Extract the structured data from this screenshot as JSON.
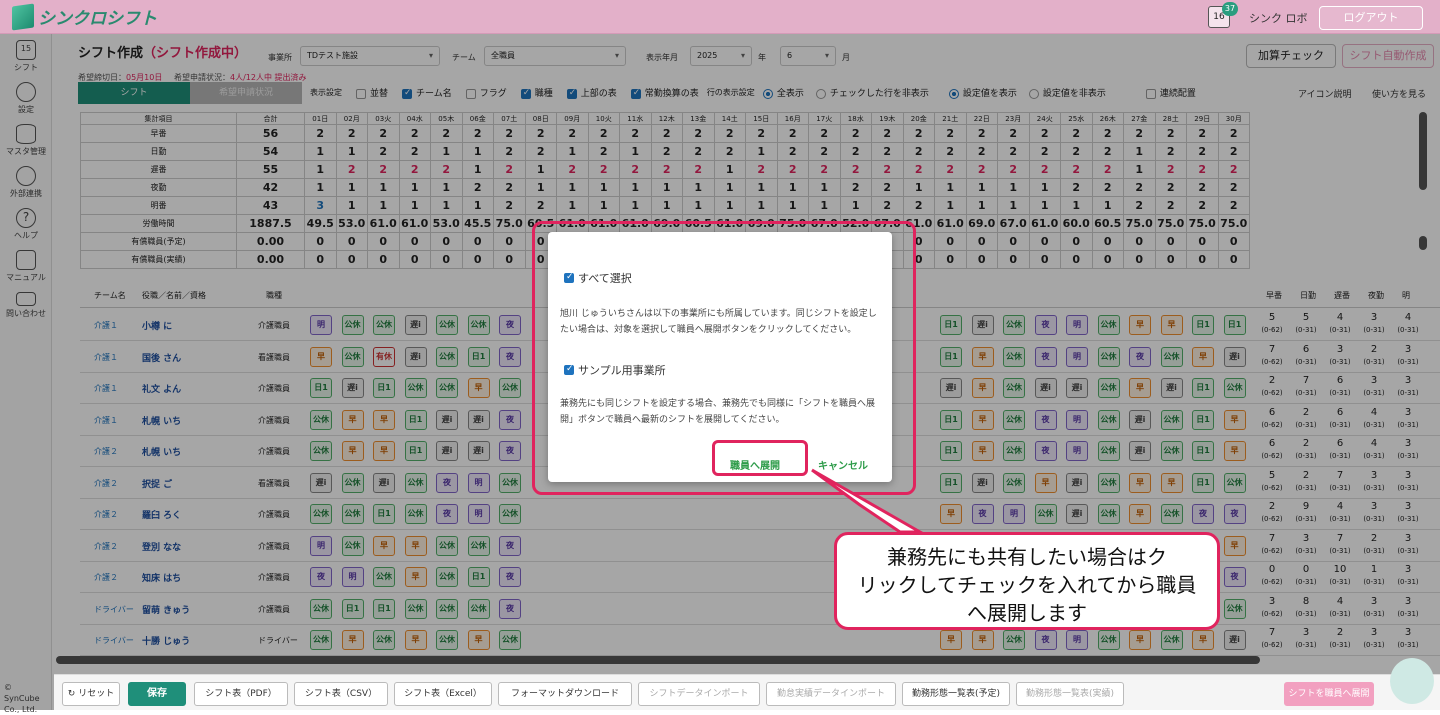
{
  "app": {
    "logo_text": "シンクロシフト",
    "cal_day": "16",
    "badge_count": "37",
    "user": "シンク ロボ",
    "logout": "ログアウト"
  },
  "sidebar": {
    "items": [
      {
        "label": "シフト",
        "icon": "calendar-icon"
      },
      {
        "label": "設定",
        "icon": "gear-icon"
      },
      {
        "label": "マスタ管理",
        "icon": "database-icon"
      },
      {
        "label": "外部連携",
        "icon": "cloud-sync-icon"
      },
      {
        "label": "ヘルプ",
        "icon": "help-icon"
      },
      {
        "label": "マニュアル",
        "icon": "edit-icon"
      },
      {
        "label": "問い合わせ",
        "icon": "mail-icon"
      }
    ],
    "cal_day": "15",
    "copyright": "© SynCube Co., Ltd."
  },
  "header": {
    "title": "シフト作成",
    "status": "（シフト作成中）",
    "office_label": "事業所",
    "office_value": "TDテスト施設",
    "team_label": "チーム",
    "team_value": "全職員",
    "ym_label": "表示年月",
    "year_value": "2025",
    "year_unit": "年",
    "month_value": "6",
    "month_unit": "月",
    "deadline_label": "希望締切日：",
    "deadline_value": "05月10日",
    "request_label": "希望申請状況：",
    "request_value": "4人/12人中 提出済み",
    "btn_check": "加算チェック",
    "btn_auto": "シフト自動作成"
  },
  "tabs": [
    {
      "label": "シフト",
      "active": true
    },
    {
      "label": "希望申請状況",
      "active": false
    }
  ],
  "options": {
    "display_label": "表示設定",
    "items": [
      {
        "label": "並替",
        "checked": false
      },
      {
        "label": "チーム名",
        "checked": true
      },
      {
        "label": "フラグ",
        "checked": false
      },
      {
        "label": "職種",
        "checked": true
      },
      {
        "label": "上部の表",
        "checked": true
      },
      {
        "label": "常勤換算の表",
        "checked": true
      }
    ],
    "row_label": "行の表示設定",
    "radios1": [
      {
        "label": "全表示",
        "on": true
      },
      {
        "label": "チェックした行を非表示",
        "on": false
      }
    ],
    "radios2": [
      {
        "label": "設定値を表示",
        "on": true
      },
      {
        "label": "設定値を非表示",
        "on": false
      }
    ],
    "renzoku": "連続配置",
    "icon_desc": "アイコン説明",
    "howto": "使い方を見る"
  },
  "summary": {
    "header": "集計項目",
    "total_label": "合計",
    "days": [
      "01日",
      "02月",
      "03火",
      "04水",
      "05木",
      "06金",
      "07土",
      "08日",
      "09月",
      "10火",
      "11水",
      "12木",
      "13金",
      "14土",
      "15日",
      "16月",
      "17火",
      "18水",
      "19木",
      "20金",
      "21土",
      "22日",
      "23月",
      "24火",
      "25水",
      "26木",
      "27金",
      "28土",
      "29日",
      "30月"
    ],
    "rows": [
      {
        "label": "早番",
        "total": "56",
        "vals": [
          "2",
          "2",
          "2",
          "2",
          "2",
          "2",
          "2",
          "2",
          "2",
          "2",
          "2",
          "2",
          "2",
          "2",
          "2",
          "2",
          "2",
          "2",
          "2",
          "2",
          "2",
          "2",
          "2",
          "2",
          "2",
          "2",
          "2",
          "2",
          "2",
          "2"
        ]
      },
      {
        "label": "日勤",
        "total": "54",
        "vals": [
          "1",
          "1",
          "2",
          "2",
          "1",
          "1",
          "2",
          "2",
          "1",
          "2",
          "1",
          "2",
          "2",
          "2",
          "1",
          "2",
          "2",
          "2",
          "2",
          "2",
          "2",
          "2",
          "2",
          "2",
          "2",
          "2",
          "1",
          "2",
          "2",
          "2"
        ]
      },
      {
        "label": "遅番",
        "total": "55",
        "vals": [
          "1",
          "2",
          "2",
          "2",
          "2",
          "1",
          "2",
          "1",
          "2",
          "2",
          "2",
          "2",
          "2",
          "1",
          "2",
          "2",
          "2",
          "2",
          "2",
          "2",
          "2",
          "2",
          "2",
          "2",
          "2",
          "2",
          "1",
          "2",
          "2",
          "2"
        ]
      },
      {
        "label": "夜勤",
        "total": "42",
        "vals": [
          "1",
          "1",
          "1",
          "1",
          "1",
          "2",
          "2",
          "1",
          "1",
          "1",
          "1",
          "1",
          "1",
          "1",
          "1",
          "1",
          "1",
          "2",
          "2",
          "1",
          "1",
          "1",
          "1",
          "1",
          "2",
          "2",
          "2",
          "2",
          "2",
          "2"
        ]
      },
      {
        "label": "明番",
        "total": "43",
        "vals": [
          "3",
          "1",
          "1",
          "1",
          "1",
          "1",
          "2",
          "2",
          "1",
          "1",
          "1",
          "1",
          "1",
          "1",
          "1",
          "1",
          "1",
          "1",
          "2",
          "2",
          "1",
          "1",
          "1",
          "1",
          "1",
          "1",
          "2",
          "2",
          "2",
          "2"
        ]
      },
      {
        "label": "労働時間",
        "total": "1887.5",
        "vals": [
          "49.5",
          "53.0",
          "61.0",
          "61.0",
          "53.0",
          "45.5",
          "75.0",
          "60.5",
          "61.0",
          "61.0",
          "61.0",
          "69.0",
          "60.5",
          "61.0",
          "69.0",
          "75.0",
          "67.0",
          "52.0",
          "67.0",
          "61.0",
          "61.0",
          "69.0",
          "67.0",
          "61.0",
          "60.0",
          "60.5",
          "75.0",
          "75.0",
          "75.0",
          "75.0"
        ]
      },
      {
        "label": "有償職員(予定)",
        "total": "0.00",
        "vals": [
          "0",
          "0",
          "0",
          "0",
          "0",
          "0",
          "0",
          "0",
          "0",
          "0",
          "0",
          "0",
          "0",
          "0",
          "0",
          "0",
          "0",
          "0",
          "0",
          "0",
          "0",
          "0",
          "0",
          "0",
          "0",
          "0",
          "0",
          "0",
          "0",
          "0"
        ]
      },
      {
        "label": "有償職員(実績)",
        "total": "0.00",
        "vals": [
          "0",
          "0",
          "0",
          "0",
          "0",
          "0",
          "0",
          "0",
          "0",
          "0",
          "0",
          "0",
          "0",
          "0",
          "0",
          "0",
          "0",
          "0",
          "0",
          "0",
          "0",
          "0",
          "0",
          "0",
          "0",
          "0",
          "0",
          "0",
          "0",
          "0"
        ]
      }
    ]
  },
  "staff_header": {
    "team": "チーム名",
    "name": "役職／名前／資格",
    "job": "職種",
    "tally": [
      "早番",
      "日勤",
      "遅番",
      "夜勤",
      "明"
    ]
  },
  "staff": [
    {
      "team": "介護１",
      "name": "小樽 に",
      "job": "介護職員",
      "shifts": [
        "明",
        "公休",
        "公休",
        "遅i",
        "公休",
        "公休",
        "夜"
      ],
      "shifts_r": [
        "日1",
        "遅i",
        "公休",
        "夜",
        "明",
        "公休",
        "早",
        "早",
        "日1",
        "日1"
      ],
      "tally": [
        [
          "5",
          "(0-62)"
        ],
        [
          "5",
          "(0-31)"
        ],
        [
          "4",
          "(0-31)"
        ],
        [
          "3",
          "(0-31)"
        ],
        [
          "4",
          "(0-31)"
        ]
      ]
    },
    {
      "team": "介護１",
      "name": "国後 さん",
      "job": "看護職員",
      "shifts": [
        "早",
        "公休",
        "有休",
        "遅i",
        "公休",
        "日1",
        "夜"
      ],
      "shifts_r": [
        "日1",
        "早",
        "公休",
        "夜",
        "明",
        "公休",
        "夜",
        "公休",
        "早",
        "遅i"
      ],
      "tally": [
        [
          "7",
          "(0-62)"
        ],
        [
          "6",
          "(0-31)"
        ],
        [
          "3",
          "(0-31)"
        ],
        [
          "2",
          "(0-31)"
        ],
        [
          "3",
          "(0-31)"
        ]
      ]
    },
    {
      "team": "介護１",
      "name": "礼文 よん",
      "job": "介護職員",
      "shifts": [
        "日1",
        "遅i",
        "日1",
        "公休",
        "公休",
        "早",
        "公休"
      ],
      "shifts_r": [
        "遅i",
        "早",
        "公休",
        "遅i",
        "遅i",
        "公休",
        "早",
        "遅i",
        "日1",
        "公休"
      ],
      "tally": [
        [
          "2",
          "(0-62)"
        ],
        [
          "7",
          "(0-31)"
        ],
        [
          "6",
          "(0-31)"
        ],
        [
          "3",
          "(0-31)"
        ],
        [
          "3",
          "(0-31)"
        ]
      ]
    },
    {
      "team": "介護１",
      "name": "札幌 いち",
      "job": "介護職員",
      "shifts": [
        "公休",
        "早",
        "早",
        "日1",
        "遅i",
        "遅i",
        "夜"
      ],
      "shifts_r": [
        "日1",
        "早",
        "公休",
        "夜",
        "明",
        "公休",
        "遅i",
        "公休",
        "日1",
        "早"
      ],
      "tally": [
        [
          "6",
          "(0-62)"
        ],
        [
          "2",
          "(0-31)"
        ],
        [
          "6",
          "(0-31)"
        ],
        [
          "4",
          "(0-31)"
        ],
        [
          "3",
          "(0-31)"
        ]
      ]
    },
    {
      "team": "介護２",
      "name": "札幌 いち",
      "job": "介護職員",
      "shifts": [
        "公休",
        "早",
        "早",
        "日1",
        "遅i",
        "遅i",
        "夜"
      ],
      "shifts_r": [
        "日1",
        "早",
        "公休",
        "夜",
        "明",
        "公休",
        "遅i",
        "公休",
        "日1",
        "早"
      ],
      "tally": [
        [
          "6",
          "(0-62)"
        ],
        [
          "2",
          "(0-31)"
        ],
        [
          "6",
          "(0-31)"
        ],
        [
          "4",
          "(0-31)"
        ],
        [
          "3",
          "(0-31)"
        ]
      ]
    },
    {
      "team": "介護２",
      "name": "択捉 ご",
      "job": "看護職員",
      "shifts": [
        "遅i",
        "公休",
        "遅i",
        "公休",
        "夜",
        "明",
        "公休"
      ],
      "shifts_r": [
        "日1",
        "遅i",
        "公休",
        "早",
        "遅i",
        "公休",
        "早",
        "早",
        "日1",
        "公休"
      ],
      "tally": [
        [
          "5",
          "(0-62)"
        ],
        [
          "2",
          "(0-31)"
        ],
        [
          "7",
          "(0-31)"
        ],
        [
          "3",
          "(0-31)"
        ],
        [
          "3",
          "(0-31)"
        ]
      ]
    },
    {
      "team": "介護２",
      "name": "羅臼 ろく",
      "job": "介護職員",
      "shifts": [
        "公休",
        "公休",
        "日1",
        "公休",
        "夜",
        "明",
        "公休"
      ],
      "shifts_r": [
        "早",
        "夜",
        "明",
        "公休",
        "遅i",
        "公休",
        "早",
        "公休",
        "夜",
        "夜"
      ],
      "tally": [
        [
          "2",
          "(0-62)"
        ],
        [
          "9",
          "(0-31)"
        ],
        [
          "4",
          "(0-31)"
        ],
        [
          "3",
          "(0-31)"
        ],
        [
          "3",
          "(0-31)"
        ]
      ]
    },
    {
      "team": "介護２",
      "name": "登別 なな",
      "job": "介護職員",
      "shifts": [
        "明",
        "公休",
        "早",
        "早",
        "公休",
        "公休",
        "夜"
      ],
      "shifts_r": [
        "日1",
        "早",
        "公休",
        "夜",
        "明",
        "公休",
        "夜",
        "公休",
        "早",
        "早"
      ],
      "tally": [
        [
          "7",
          "(0-62)"
        ],
        [
          "3",
          "(0-31)"
        ],
        [
          "7",
          "(0-31)"
        ],
        [
          "2",
          "(0-31)"
        ],
        [
          "3",
          "(0-31)"
        ]
      ]
    },
    {
      "team": "介護２",
      "name": "知床 はち",
      "job": "介護職員",
      "shifts": [
        "夜",
        "明",
        "公休",
        "早",
        "公休",
        "日1",
        "夜"
      ],
      "shifts_r": [
        "日1",
        "早",
        "公休",
        "夜",
        "明",
        "公休",
        "夜",
        "公休",
        "早",
        "夜"
      ],
      "tally": [
        [
          "0",
          "(0-62)"
        ],
        [
          "0",
          "(0-31)"
        ],
        [
          "10",
          "(0-31)"
        ],
        [
          "1",
          "(0-31)"
        ],
        [
          "3",
          "(0-31)"
        ]
      ]
    },
    {
      "team": "ドライバー",
      "name": "留萌 きゅう",
      "job": "介護職員",
      "shifts": [
        "公休",
        "日1",
        "日1",
        "公休",
        "公休",
        "公休",
        "夜"
      ],
      "shifts_r": [
        "日1",
        "早",
        "公休",
        "遅i",
        "明",
        "公休",
        "早",
        "遅i",
        "日1",
        "公休"
      ],
      "tally": [
        [
          "3",
          "(0-62)"
        ],
        [
          "8",
          "(0-31)"
        ],
        [
          "4",
          "(0-31)"
        ],
        [
          "3",
          "(0-31)"
        ],
        [
          "3",
          "(0-31)"
        ]
      ]
    },
    {
      "team": "ドライバー",
      "name": "十勝 じゅう",
      "job": "ドライバー",
      "shifts": [
        "公休",
        "早",
        "公休",
        "早",
        "公休",
        "早",
        "公休"
      ],
      "shifts_r": [
        "早",
        "早",
        "公休",
        "夜",
        "明",
        "公休",
        "早",
        "公休",
        "早",
        "遅i"
      ],
      "tally": [
        [
          "7",
          "(0-62)"
        ],
        [
          "3",
          "(0-31)"
        ],
        [
          "2",
          "(0-31)"
        ],
        [
          "3",
          "(0-31)"
        ],
        [
          "3",
          "(0-31)"
        ]
      ]
    }
  ],
  "modal": {
    "select_all": "すべて選択",
    "message1": "旭川 じゅういちさんは以下の事業所にも所属しています。同じシフトを設定したい場合は、対象を選択して職員へ展開ボタンをクリックしてください。",
    "office": "サンプル用事業所",
    "message2": "兼務先にも同じシフトを設定する場合、兼務先でも同様に「シフトを職員へ展開」ボタンで職員へ最新のシフトを展開してください。",
    "btn_expand": "職員へ展開",
    "btn_cancel": "キャンセル"
  },
  "callout": {
    "line1": "兼務先にも共有したい場合はク",
    "line2": "リックしてチェックを入れてから職員",
    "line3": "へ展開します"
  },
  "bottom": {
    "reset": "リセット",
    "save": "保存",
    "pdf": "シフト表（PDF）",
    "csv": "シフト表（CSV）",
    "excel": "シフト表（Excel）",
    "format": "フォーマットダウンロード",
    "import": "シフトデータインポート",
    "attendance": "勤怠実績データインポート",
    "plan": "勤務形態一覧表(予定)",
    "actual": "勤務形態一覧表(実績)",
    "expand": "シフトを職員へ展開"
  }
}
